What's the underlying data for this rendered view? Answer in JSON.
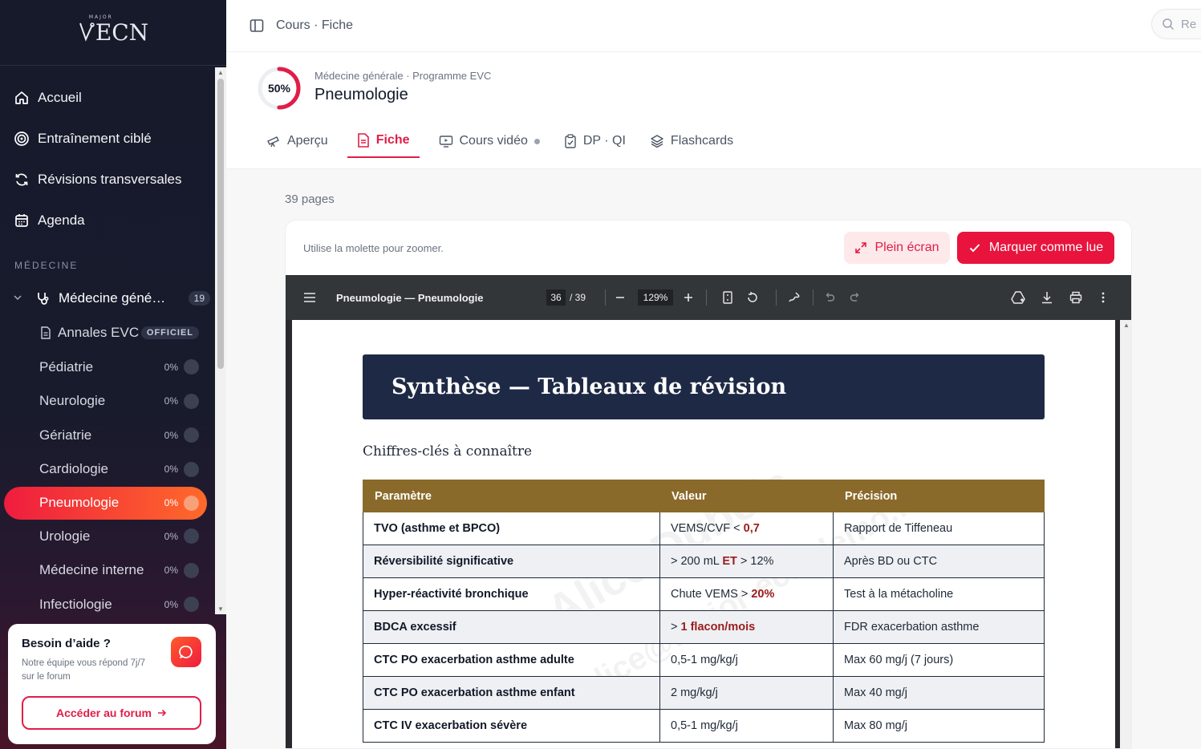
{
  "app": {
    "logo_text": "ECN",
    "logo_superscript": "MAJOR"
  },
  "sidebar": {
    "nav": [
      {
        "label": "Accueil",
        "icon": "home-icon"
      },
      {
        "label": "Entraînement ciblé",
        "icon": "target-icon"
      },
      {
        "label": "Révisions transversales",
        "icon": "refresh-icon"
      },
      {
        "label": "Agenda",
        "icon": "calendar-icon"
      }
    ],
    "section_label": "MÉDECINE",
    "group": {
      "label": "Médecine géné…",
      "count": "19"
    },
    "annales": {
      "label": "Annales EVC",
      "badge": "OFFICIEL"
    },
    "specialties": [
      {
        "label": "Pédiatrie",
        "pct": "0%"
      },
      {
        "label": "Neurologie",
        "pct": "0%"
      },
      {
        "label": "Gériatrie",
        "pct": "0%"
      },
      {
        "label": "Cardiologie",
        "pct": "0%"
      },
      {
        "label": "Pneumologie",
        "pct": "0%",
        "active": true
      },
      {
        "label": "Urologie",
        "pct": "0%"
      },
      {
        "label": "Médecine interne",
        "pct": "0%"
      },
      {
        "label": "Infectiologie",
        "pct": "0%"
      }
    ],
    "help": {
      "title": "Besoin d’aide ?",
      "text": "Notre équipe vous répond 7j/7 sur le forum",
      "button": "Accéder au forum"
    }
  },
  "topbar": {
    "breadcrumb": "Cours · Fiche",
    "search_placeholder": "Re"
  },
  "course": {
    "progress_label": "50%",
    "progress_value": 0.5,
    "subtitle": "Médecine générale · Programme EVC",
    "title": "Pneumologie"
  },
  "tabs": [
    {
      "label": "Aperçu",
      "icon": "telescope-icon"
    },
    {
      "label": "Fiche",
      "icon": "document-icon",
      "active": true
    },
    {
      "label": "Cours vidéo",
      "icon": "video-icon"
    },
    {
      "label": "DP · QI",
      "icon": "clipboard-icon"
    },
    {
      "label": "Flashcards",
      "icon": "layers-icon"
    }
  ],
  "viewer": {
    "pages_label": "39 pages",
    "hint": "Utilise la molette pour zoomer.",
    "fullscreen_label": "Plein écran",
    "mark_read_label": "Marquer comme lue",
    "pdf_title": "Pneumologie — Pneumologie",
    "current_page": "36",
    "total_pages": "/ 39",
    "zoom": "129%"
  },
  "document": {
    "banner": "Synthèse — Tableaux de révision",
    "section": "Chiffres-clés à connaître",
    "watermark_name": "Alice Dubois",
    "watermark_email": "alice@major-ecn-demo.fr",
    "headers": [
      "Paramètre",
      "Valeur",
      "Précision"
    ],
    "rows": [
      {
        "param": "TVO (asthme et BPCO)",
        "value_pre": "VEMS/CVF < ",
        "value_hl": "0,7",
        "value_post": "",
        "precision": "Rapport de Tiffeneau"
      },
      {
        "param": "Réversibilité significative",
        "value_pre": "> 200 mL ",
        "value_hl": "ET",
        "value_post": " > 12%",
        "precision": "Après BD ou CTC"
      },
      {
        "param": "Hyper-réactivité bronchique",
        "value_pre": "Chute VEMS > ",
        "value_hl": "20%",
        "value_post": "",
        "precision": "Test à la métacholine"
      },
      {
        "param": "BDCA excessif",
        "value_pre": "> ",
        "value_hl": "1 flacon/mois",
        "value_post": "",
        "precision": "FDR exacerbation asthme"
      },
      {
        "param": "CTC PO exacerbation asthme adulte",
        "value_pre": "0,5-1 mg/kg/j",
        "value_hl": "",
        "value_post": "",
        "precision": "Max 60 mg/j (7 jours)"
      },
      {
        "param": "CTC PO exacerbation asthme enfant",
        "value_pre": "2 mg/kg/j",
        "value_hl": "",
        "value_post": "",
        "precision": "Max 40 mg/j"
      },
      {
        "param": "CTC IV exacerbation sévère",
        "value_pre": "0,5-1 mg/kg/j",
        "value_hl": "",
        "value_post": "",
        "precision": "Max 80 mg/j"
      }
    ]
  }
}
